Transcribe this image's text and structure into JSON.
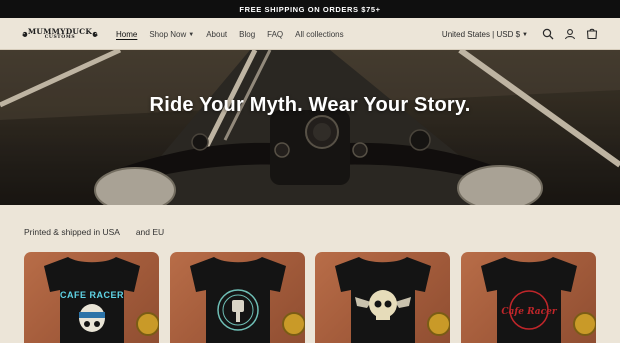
{
  "announcement": {
    "text": "FREE SHIPPING ON ORDERS $75+"
  },
  "brand": {
    "logo_main": "MUMMYDUCK",
    "logo_sub": "CUSTOMS"
  },
  "nav": {
    "items": [
      {
        "label": "Home",
        "active": true
      },
      {
        "label": "Shop Now",
        "dropdown": true
      },
      {
        "label": "About"
      },
      {
        "label": "Blog"
      },
      {
        "label": "FAQ"
      },
      {
        "label": "All collections"
      }
    ]
  },
  "header_right": {
    "country_selector": "United States | USD $",
    "icons": [
      "search-icon",
      "account-icon",
      "cart-icon"
    ]
  },
  "hero": {
    "title": "Ride Your Myth. Wear Your Story."
  },
  "info": {
    "text_1": "Printed & shipped in USA",
    "text_2": "and EU"
  },
  "products": [
    {
      "design": "skull-cafe-racer-tee",
      "print_text": "CAFE RACER"
    },
    {
      "design": "piston-emblem-tee",
      "print_text": ""
    },
    {
      "design": "winged-skull-tee",
      "print_text": ""
    },
    {
      "design": "cafe-racer-script-tee",
      "print_text": "Cafe Racer"
    }
  ],
  "colors": {
    "background": "#ece5d8",
    "announcement_bg": "#0f0f0f",
    "card_bg": "#a55d3c",
    "shirt": "#141414"
  }
}
